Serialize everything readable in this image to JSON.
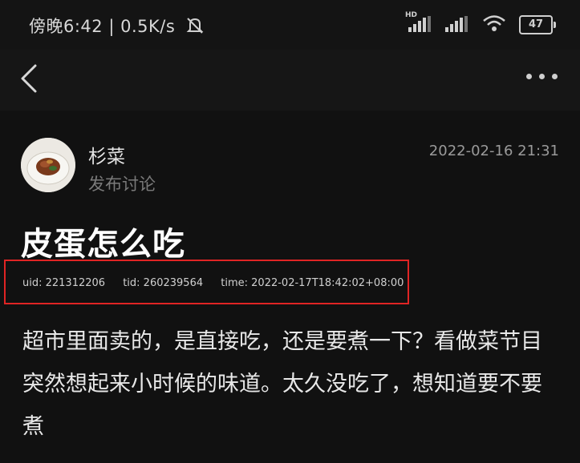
{
  "status_bar": {
    "time_speed": "傍晚6:42 | 0.5K/s",
    "network_label": "HD",
    "battery": "47",
    "icons": [
      "mute-icon",
      "signal-icon",
      "wifi-icon",
      "battery-icon"
    ]
  },
  "nav": {
    "icons": [
      "back-icon",
      "more-icon"
    ]
  },
  "post": {
    "author": "杉菜",
    "subtitle": "发布讨论",
    "date": "2022-02-16 21:31",
    "title": "皮蛋怎么吃",
    "meta": {
      "uid": "uid: 221312206",
      "tid": "tid: 260239564",
      "time": "time: 2022-02-17T18:42:02+08:00"
    },
    "body": "超市里面卖的，是直接吃，还是要煮一下？看做菜节目突然想起来小时候的味道。太久没吃了，想知道要不要煮"
  },
  "colors": {
    "background": "#111111",
    "highlight_border": "#e02424"
  }
}
